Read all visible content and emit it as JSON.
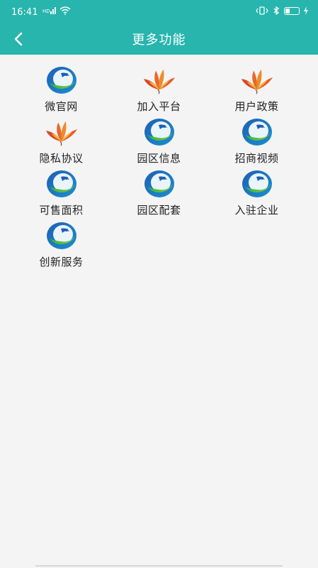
{
  "status_bar": {
    "time": "16:41",
    "battery_level": 0.35
  },
  "header": {
    "title": "更多功能",
    "back_icon": "chevron-left-icon"
  },
  "colors": {
    "header_bg": "#27b5ad",
    "page_bg": "#f4f4f4"
  },
  "menu": {
    "items": [
      {
        "label": "微官网",
        "icon": "park-logo-icon"
      },
      {
        "label": "加入平台",
        "icon": "lotus-icon"
      },
      {
        "label": "用户政策",
        "icon": "lotus-icon"
      },
      {
        "label": "隐私协议",
        "icon": "lotus-icon"
      },
      {
        "label": "园区信息",
        "icon": "park-logo-icon"
      },
      {
        "label": "招商视频",
        "icon": "park-logo-icon"
      },
      {
        "label": "可售面积",
        "icon": "park-logo-icon"
      },
      {
        "label": "园区配套",
        "icon": "park-logo-icon"
      },
      {
        "label": "入驻企业",
        "icon": "park-logo-icon"
      },
      {
        "label": "创新服务",
        "icon": "park-logo-icon"
      }
    ]
  }
}
